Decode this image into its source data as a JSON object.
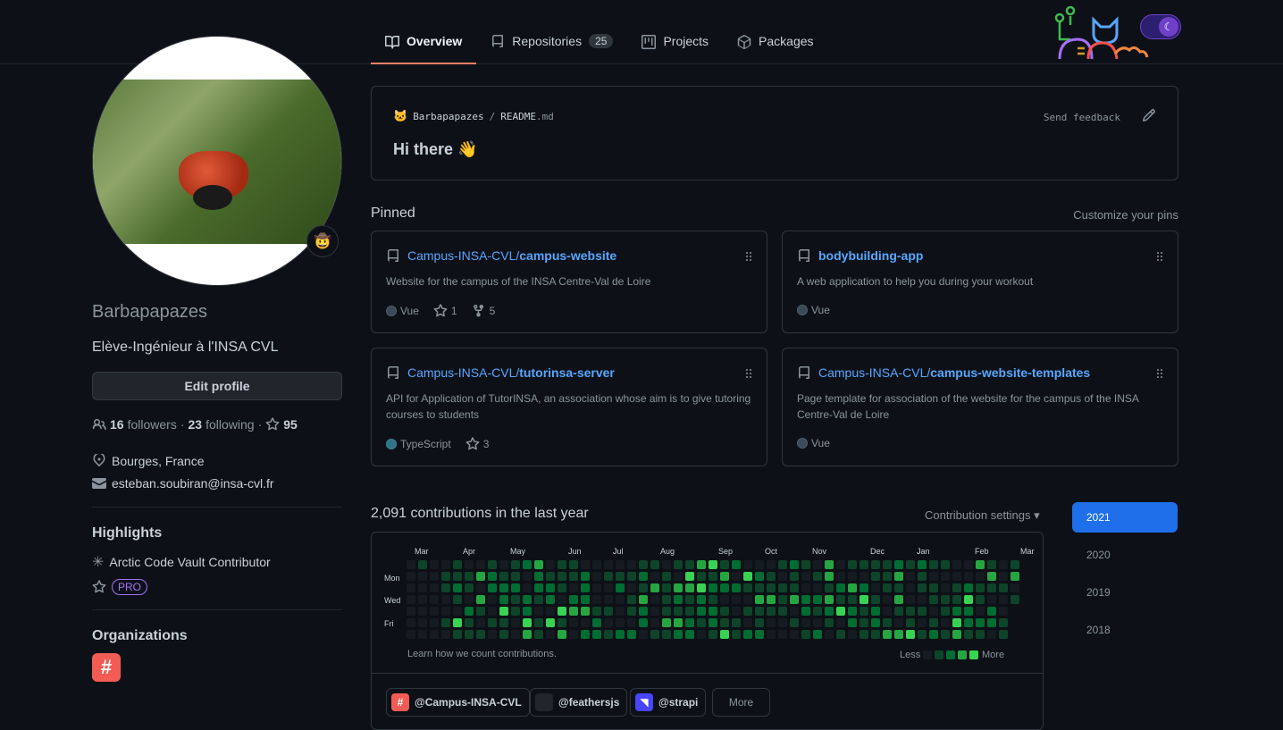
{
  "nav": {
    "tabs": [
      {
        "label": "Overview",
        "icon": "book-icon",
        "active": true
      },
      {
        "label": "Repositories",
        "icon": "repo-icon",
        "count": "25"
      },
      {
        "label": "Projects",
        "icon": "project-icon"
      },
      {
        "label": "Packages",
        "icon": "package-icon"
      }
    ]
  },
  "profile": {
    "username": "Barbapapazes",
    "bio": "Elève-Ingénieur à l'INSA CVL",
    "edit_label": "Edit profile",
    "followers_count": "16",
    "followers_label": "followers",
    "following_count": "23",
    "following_label": "following",
    "stars": "95",
    "location": "Bourges, France",
    "email": "esteban.soubiran@insa-cvl.fr",
    "status_emoji": "🤠"
  },
  "highlights": {
    "title": "Highlights",
    "items": [
      "Arctic Code Vault Contributor"
    ],
    "pro_badge": "PRO"
  },
  "organizations": {
    "title": "Organizations",
    "icon_glyph": "#"
  },
  "readme": {
    "owner": "Barbapapazes",
    "sep": "/",
    "file": "README",
    "ext": ".md",
    "feedback": "Send feedback",
    "heading": "Hi there 👋"
  },
  "pinned": {
    "title": "Pinned",
    "customize": "Customize your pins",
    "cards": [
      {
        "owner": "Campus-INSA-CVL/",
        "name": "campus-website",
        "desc": "Website for the campus of the INSA Centre-Val de Loire",
        "lang": "Vue",
        "lang_color": "#41b883",
        "stars": "1",
        "forks": "5"
      },
      {
        "owner": "",
        "name": "bodybuilding-app",
        "desc": "A web application to help you during your workout",
        "lang": "Vue",
        "lang_color": "#41b883"
      },
      {
        "owner": "Campus-INSA-CVL/",
        "name": "tutorinsa-server",
        "desc": "API for Application of TutorINSA, an association whose aim is to give tutoring courses to students",
        "lang": "TypeScript",
        "lang_color": "#2b7489",
        "stars": "3"
      },
      {
        "owner": "Campus-INSA-CVL/",
        "name": "campus-website-templates",
        "desc": "Page template for association of the website for the campus of the INSA Centre-Val de Loire",
        "lang": "Vue",
        "lang_color": "#41b883"
      }
    ]
  },
  "contributions": {
    "title": "2,091 contributions in the last year",
    "settings": "Contribution settings ▾",
    "months": [
      "Mar",
      "Apr",
      "May",
      "Jun",
      "Jul",
      "Aug",
      "Sep",
      "Oct",
      "Nov",
      "Dec",
      "Jan",
      "Feb",
      "Mar"
    ],
    "days": [
      "Mon",
      "Wed",
      "Fri"
    ],
    "learn": "Learn how we count contributions.",
    "less": "Less",
    "more": "More",
    "levels": [
      "#161b22",
      "#0e4429",
      "#006d32",
      "#26a641",
      "#39d353"
    ]
  },
  "activity_orgs": {
    "items": [
      {
        "label": "@Campus-INSA-CVL",
        "color": "#f25c54",
        "glyph": "#"
      },
      {
        "label": "@feathersjs",
        "color": "#21262d",
        "glyph": ""
      },
      {
        "label": "@strapi",
        "color": "#4945ff",
        "glyph": "◥"
      }
    ],
    "more": "More"
  },
  "years": [
    "2021",
    "2020",
    "2019",
    "2018"
  ]
}
